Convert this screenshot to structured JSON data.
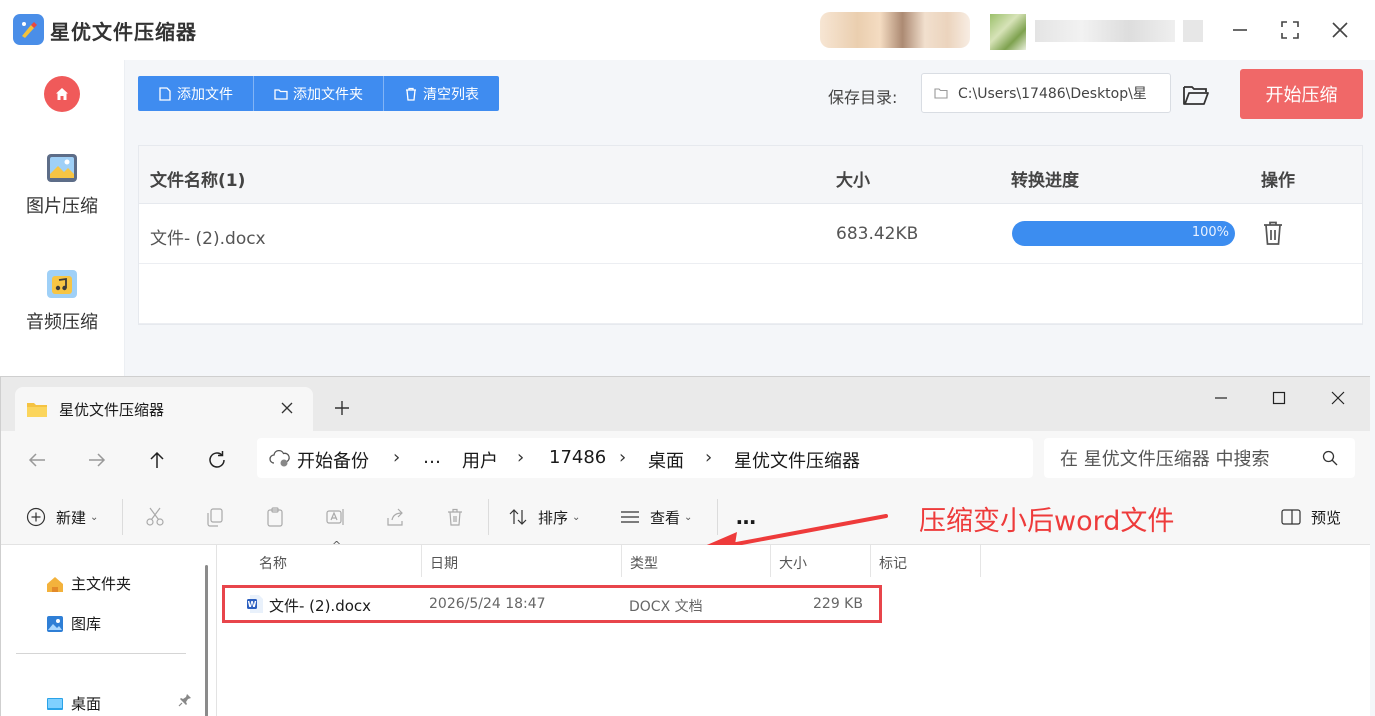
{
  "app": {
    "title": "星优文件压缩器",
    "sidebar": [
      {
        "label": "图片压缩",
        "icon": "image-icon"
      },
      {
        "label": "音频压缩",
        "icon": "audio-icon"
      }
    ],
    "toolbar": {
      "add_file": "添加文件",
      "add_folder": "添加文件夹",
      "clear_list": "清空列表",
      "save_label": "保存目录:",
      "save_path": "C:\\Users\\17486\\Desktop\\星",
      "start": "开始压缩"
    },
    "table": {
      "headers": [
        "文件名称(1)",
        "大小",
        "转换进度",
        "操作"
      ],
      "rows": [
        {
          "name": "文件- (2).docx",
          "size": "683.42KB",
          "progress": 100,
          "progress_label": "100%"
        }
      ]
    },
    "colors": {
      "accent": "#3f8cf0",
      "start": "#f06868",
      "home": "#f05a5a"
    }
  },
  "explorer": {
    "tab_title": "星优文件压缩器",
    "breadcrumb": [
      "开始备份",
      "…",
      "用户",
      "17486",
      "桌面",
      "星优文件压缩器"
    ],
    "search_placeholder": "在 星优文件压缩器 中搜索",
    "toolbar": {
      "new": "新建",
      "sort": "排序",
      "view": "查看",
      "more": "…",
      "preview": "预览"
    },
    "annotation": "压缩变小后word文件",
    "nav": [
      "主文件夹",
      "图库",
      "桌面"
    ],
    "columns": [
      "名称",
      "日期",
      "类型",
      "大小",
      "标记"
    ],
    "files": [
      {
        "name": "文件- (2).docx",
        "date": "2026/5/24 18:47",
        "type": "DOCX 文档",
        "size": "229 KB"
      }
    ]
  }
}
